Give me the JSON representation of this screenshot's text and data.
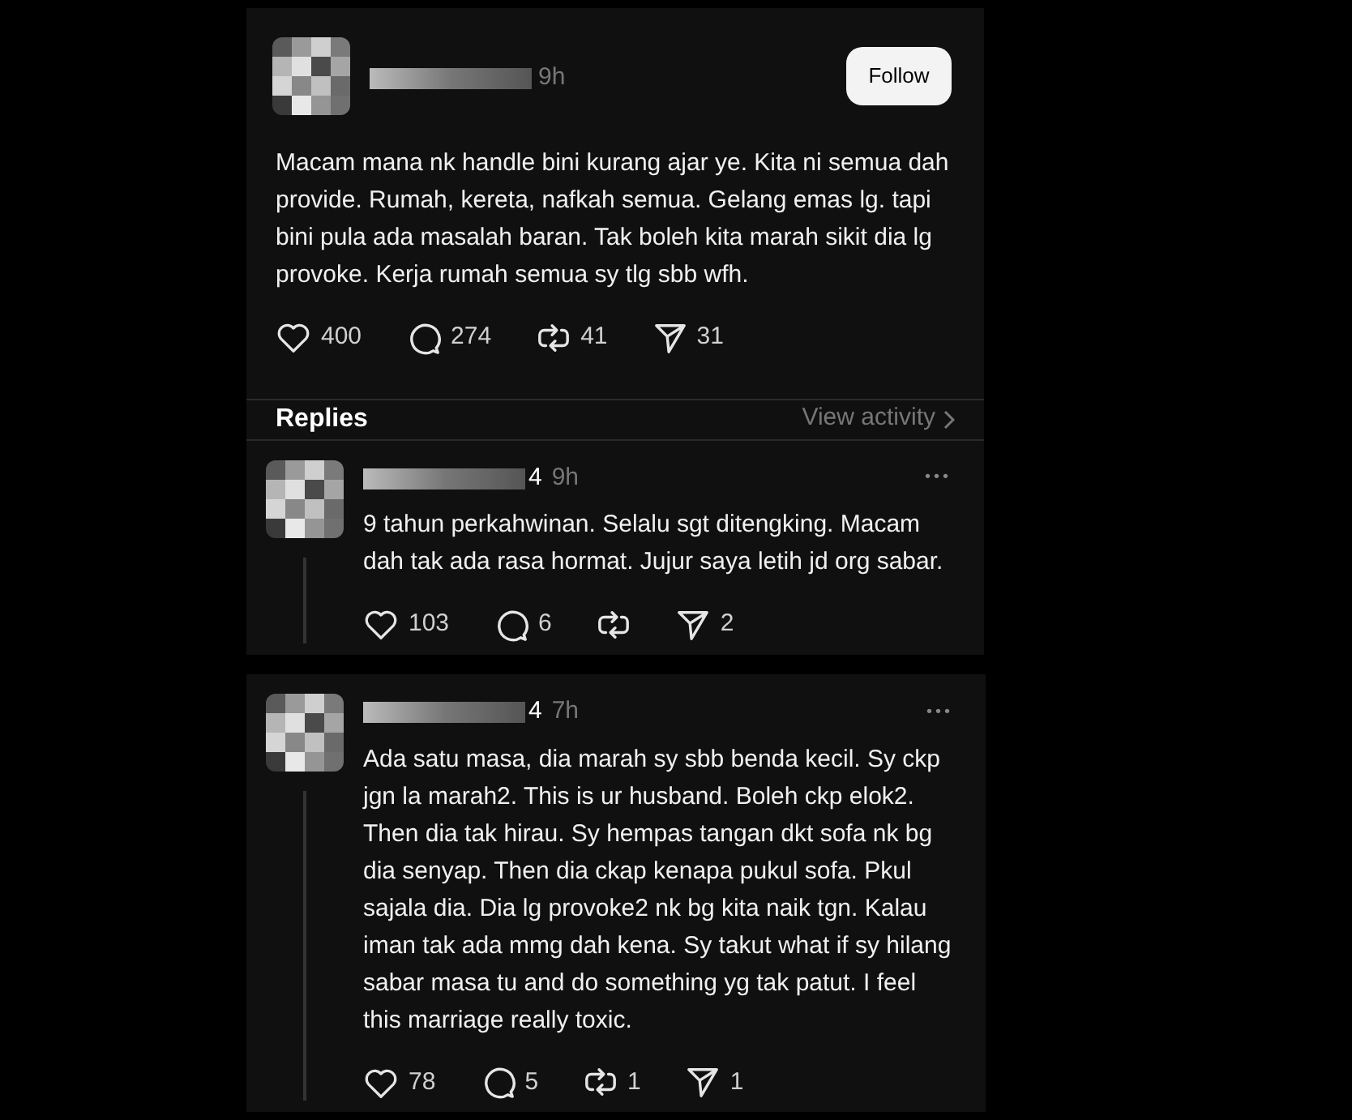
{
  "post": {
    "time": "9h",
    "follow": "Follow",
    "text": "Macam mana nk handle bini kurang ajar ye. Kita ni semua dah provide. Rumah, kereta, nafkah semua. Gelang emas lg. tapi bini pula ada masalah baran. Tak boleh kita marah sikit dia lg provoke. Kerja rumah semua sy tlg sbb wfh.",
    "stats": {
      "likes": "400",
      "comments": "274",
      "reposts": "41",
      "shares": "31"
    }
  },
  "replies_header": {
    "title": "Replies",
    "link": "View activity"
  },
  "replies": [
    {
      "name_end": "4",
      "time": "9h",
      "more": "•••",
      "text": "9 tahun perkahwinan. Selalu sgt ditengking. Macam dah tak ada rasa hormat. Jujur saya letih jd org sabar.",
      "stats": {
        "likes": "103",
        "comments": "6",
        "shares": "2"
      }
    },
    {
      "name_end": "4",
      "time": "7h",
      "more": "•••",
      "text": "Ada satu masa, dia marah sy sbb benda kecil. Sy ckp jgn la marah2. This is ur husband. Boleh ckp elok2. Then dia tak hirau. Sy hempas tangan dkt sofa nk bg dia senyap. Then dia ckap kenapa pukul sofa. Pkul sajala dia. Dia lg provoke2 nk bg kita naik tgn. Kalau iman tak ada mmg dah kena. Sy takut what if sy hilang sabar masa tu and do something yg tak patut. I feel this marriage really toxic.",
      "stats": {
        "likes": "78",
        "comments": "5",
        "reposts": "1",
        "shares": "1"
      }
    }
  ]
}
